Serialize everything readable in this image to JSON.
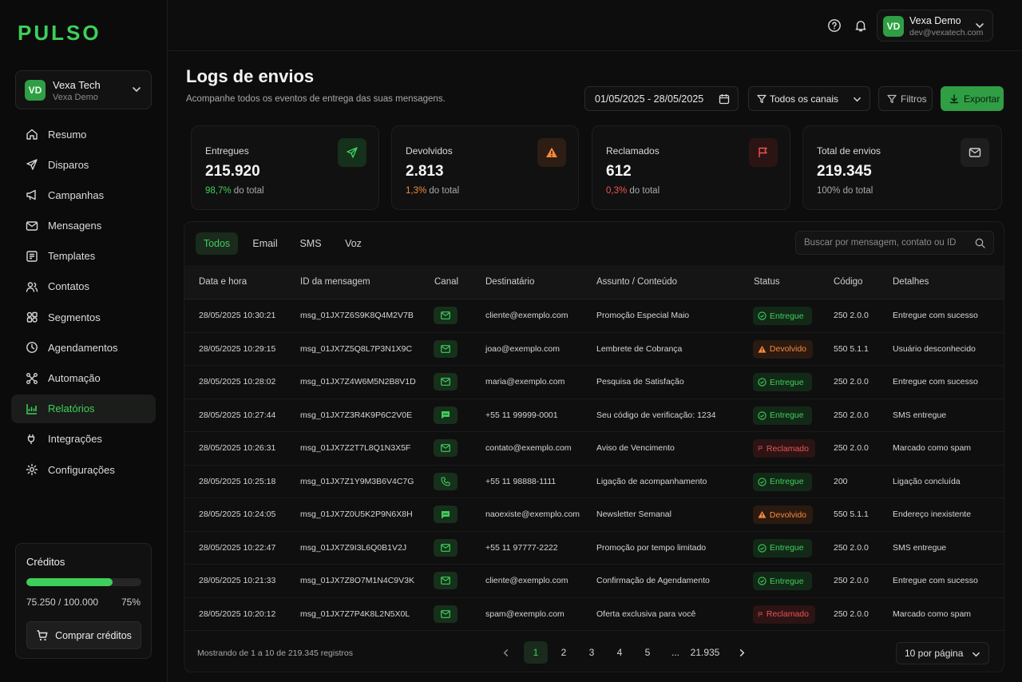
{
  "brand": "PULSO",
  "colors": {
    "accent": "#3ecf5a",
    "bounce": "#f38a3e",
    "spam": "#ef5353",
    "bg": "#0d0d0d"
  },
  "workspace": {
    "initials": "VD",
    "name": "Vexa Tech",
    "sub": "Vexa Demo"
  },
  "nav": [
    {
      "label": "Resumo",
      "icon": "home-icon"
    },
    {
      "label": "Disparos",
      "icon": "send-icon"
    },
    {
      "label": "Campanhas",
      "icon": "megaphone-icon"
    },
    {
      "label": "Mensagens",
      "icon": "mail-icon"
    },
    {
      "label": "Templates",
      "icon": "template-icon"
    },
    {
      "label": "Contatos",
      "icon": "users-icon"
    },
    {
      "label": "Segmentos",
      "icon": "segments-icon"
    },
    {
      "label": "Agendamentos",
      "icon": "clock-icon"
    },
    {
      "label": "Automação",
      "icon": "automation-icon"
    },
    {
      "label": "Relatórios",
      "icon": "chart-icon",
      "active": true
    },
    {
      "label": "Integrações",
      "icon": "plug-icon"
    },
    {
      "label": "Configurações",
      "icon": "gear-icon"
    }
  ],
  "credits": {
    "title": "Créditos",
    "count": "75.250 / 100.000",
    "percent": "75%",
    "fraction": 0.7525,
    "buy_label": "Comprar créditos"
  },
  "user": {
    "initials": "VD",
    "name": "Vexa Demo",
    "email": "dev@vexatech.com"
  },
  "header": {
    "title": "Logs de envios",
    "subtitle": "Acompanhe todos os eventos de entrega das suas mensagens.",
    "date_range": "01/05/2025 - 28/05/2025",
    "channels": "Todos os canais",
    "filters": "Filtros",
    "export": "Exportar"
  },
  "stats": [
    {
      "label": "Entregues",
      "value": "215.920",
      "note_pct": "98,7%",
      "note_rest": " do total",
      "kind": "ok",
      "icon": "send-icon"
    },
    {
      "label": "Devolvidos",
      "value": "2.813",
      "note_pct": "1,3%",
      "note_rest": " do total",
      "kind": "bounce",
      "icon": "warning-icon"
    },
    {
      "label": "Reclamados",
      "value": "612",
      "note_pct": "0,3%",
      "note_rest": " do total",
      "kind": "spam",
      "icon": "flag-icon"
    },
    {
      "label": "Total de envios",
      "value": "219.345",
      "note_pct": "",
      "note_rest": "100% do total",
      "kind": "neutral",
      "icon": "mail-icon"
    }
  ],
  "tabs": [
    "Todos",
    "Email",
    "SMS",
    "Voz"
  ],
  "search_placeholder": "Buscar por mensagem, contato ou ID",
  "columns": [
    "Data e hora",
    "ID da mensagem",
    "Canal",
    "Destinatário",
    "Assunto / Conteúdo",
    "Status",
    "Código",
    "Detalhes"
  ],
  "rows": [
    {
      "date": "28/05/2025 10:30:21",
      "id": "msg_01JX7Z6S9K8Q4M2V7B",
      "channel": "email",
      "to": "cliente@exemplo.com",
      "subject": "Promoção Especial Maio",
      "status": "Entregue",
      "kind": "ok",
      "code": "250 2.0.0",
      "details": "Entregue com sucesso"
    },
    {
      "date": "28/05/2025 10:29:15",
      "id": "msg_01JX7Z5Q8L7P3N1X9C",
      "channel": "email",
      "to": "joao@exemplo.com",
      "subject": "Lembrete de Cobrança",
      "status": "Devolvido",
      "kind": "bounce",
      "code": "550 5.1.1",
      "details": "Usuário desconhecido"
    },
    {
      "date": "28/05/2025 10:28:02",
      "id": "msg_01JX7Z4W6M5N2B8V1D",
      "channel": "email",
      "to": "maria@exemplo.com",
      "subject": "Pesquisa de Satisfação",
      "status": "Entregue",
      "kind": "ok",
      "code": "250 2.0.0",
      "details": "Entregue com sucesso"
    },
    {
      "date": "28/05/2025 10:27:44",
      "id": "msg_01JX7Z3R4K9P6C2V0E",
      "channel": "sms",
      "to": "+55 11 99999-0001",
      "subject": "Seu código de verificação: 1234",
      "status": "Entregue",
      "kind": "ok",
      "code": "250 2.0.0",
      "details": "SMS entregue"
    },
    {
      "date": "28/05/2025 10:26:31",
      "id": "msg_01JX7Z2T7L8Q1N3X5F",
      "channel": "email",
      "to": "contato@exemplo.com",
      "subject": "Aviso de Vencimento",
      "status": "Reclamado",
      "kind": "spam",
      "code": "250 2.0.0",
      "details": "Marcado como spam"
    },
    {
      "date": "28/05/2025 10:25:18",
      "id": "msg_01JX7Z1Y9M3B6V4C7G",
      "channel": "voice",
      "to": "+55 11 98888-1111",
      "subject": "Ligação de acompanhamento",
      "status": "Entregue",
      "kind": "ok",
      "code": "200",
      "details": "Ligação concluída"
    },
    {
      "date": "28/05/2025 10:24:05",
      "id": "msg_01JX7Z0U5K2P9N6X8H",
      "channel": "sms",
      "to": "naoexiste@exemplo.com",
      "subject": "Newsletter Semanal",
      "status": "Devolvido",
      "kind": "bounce",
      "code": "550 5.1.1",
      "details": "Endereço inexistente"
    },
    {
      "date": "28/05/2025 10:22:47",
      "id": "msg_01JX7Z9I3L6Q0B1V2J",
      "channel": "email",
      "to": "+55 11 97777-2222",
      "subject": "Promoção por tempo limitado",
      "status": "Entregue",
      "kind": "ok",
      "code": "250 2.0.0",
      "details": "SMS entregue"
    },
    {
      "date": "28/05/2025 10:21:33",
      "id": "msg_01JX7Z8O7M1N4C9V3K",
      "channel": "email",
      "to": "cliente@exemplo.com",
      "subject": "Confirmação de Agendamento",
      "status": "Entregue",
      "kind": "ok",
      "code": "250 2.0.0",
      "details": "Entregue com sucesso"
    },
    {
      "date": "28/05/2025 10:20:12",
      "id": "msg_01JX7Z7P4K8L2N5X0L",
      "channel": "email",
      "to": "spam@exemplo.com",
      "subject": "Oferta exclusiva para você",
      "status": "Reclamado",
      "kind": "spam",
      "code": "250 2.0.0",
      "details": "Marcado como spam"
    }
  ],
  "footer": {
    "showing": "Mostrando de 1 a 10 de 219.345 registros",
    "pages": [
      "1",
      "2",
      "3",
      "4",
      "5",
      "...",
      "21.935"
    ],
    "current_page": "1",
    "per_page": "10 por página"
  }
}
